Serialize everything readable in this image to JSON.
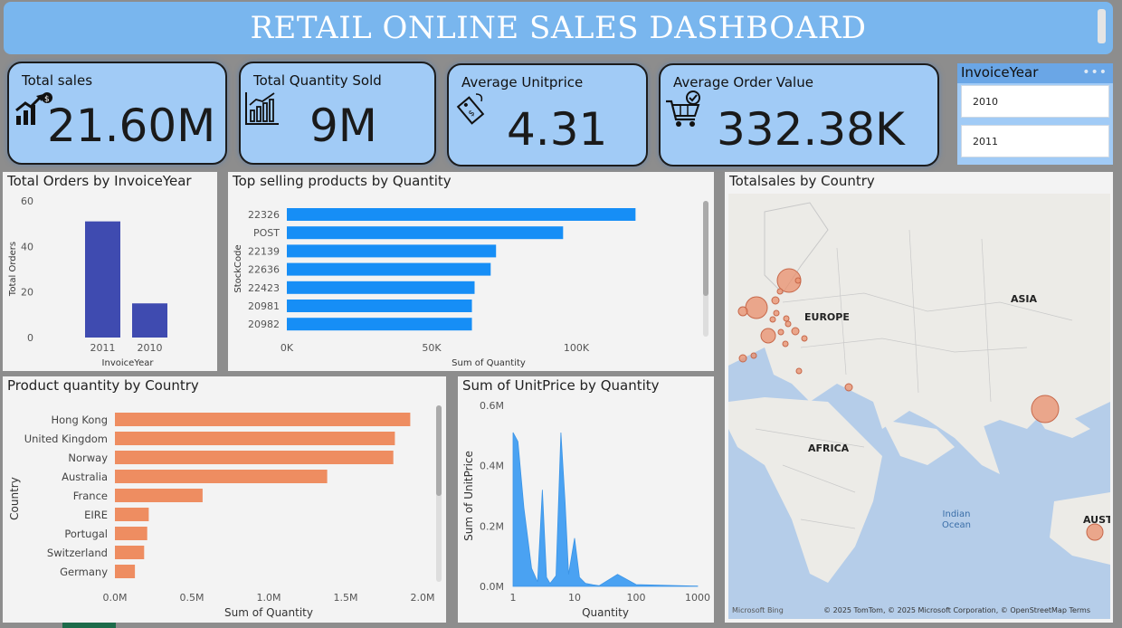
{
  "header": {
    "title": "RETAIL ONLINE SALES DASHBOARD"
  },
  "kpis": [
    {
      "label": "Total sales",
      "value": "21.60M",
      "icon": "sales-growth-icon"
    },
    {
      "label": "Total Quantity Sold",
      "value": "9M",
      "icon": "bar-chart-icon"
    },
    {
      "label": "Average Unitprice",
      "value": "4.31",
      "icon": "price-tag-icon"
    },
    {
      "label": "Average Order Value",
      "value": "332.38K",
      "icon": "shopping-cart-icon"
    }
  ],
  "slicer": {
    "title": "InvoiceYear",
    "options": [
      "2010",
      "2011"
    ]
  },
  "panels": {
    "orders_by_year": "Total Orders by InvoiceYear",
    "top_products": "Top selling products by Quantity",
    "sales_by_country": "Totalsales by Country",
    "qty_by_country": "Product quantity by Country",
    "unitprice_by_qty": "Sum of UnitPrice by Quantity"
  },
  "map": {
    "labels": [
      "EUROPE",
      "ASIA",
      "AFRICA",
      "AUSTI"
    ],
    "ocean": "Indian Ocean",
    "credit": "© 2025 TomTom, © 2025 Microsoft Corporation, © OpenStreetMap  Terms",
    "provider": "Microsoft Bing"
  },
  "chart_data": [
    {
      "type": "bar",
      "title": "Total Orders by InvoiceYear",
      "xlabel": "InvoiceYear",
      "ylabel": "Total Orders",
      "categories": [
        "2011",
        "2010"
      ],
      "values": [
        51,
        15
      ],
      "ylim": [
        0,
        60
      ],
      "yticks": [
        0,
        20,
        40,
        60
      ],
      "color": "#3f4bb0"
    },
    {
      "type": "bar",
      "orientation": "horizontal",
      "title": "Top selling products by Quantity",
      "xlabel": "Sum of Quantity",
      "ylabel": "StockCode",
      "categories": [
        "22326",
        "POST",
        "22139",
        "22636",
        "22423",
        "20981",
        "20982"
      ],
      "values": [
        130000,
        103000,
        78000,
        76000,
        70000,
        69000,
        69000
      ],
      "xlim": [
        0,
        140000
      ],
      "xticks": [
        "0K",
        "50K",
        "100K"
      ],
      "color": "#168ef6"
    },
    {
      "type": "bar",
      "orientation": "horizontal",
      "title": "Product quantity by Country",
      "xlabel": "Sum of Quantity",
      "ylabel": "Country",
      "categories": [
        "Hong Kong",
        "United Kingdom",
        "Norway",
        "Australia",
        "France",
        "EIRE",
        "Portugal",
        "Switzerland",
        "Germany"
      ],
      "values": [
        1920000,
        1820000,
        1810000,
        1380000,
        570000,
        220000,
        210000,
        190000,
        130000
      ],
      "xlim": [
        0,
        2000000
      ],
      "xticks": [
        "0.0M",
        "0.5M",
        "1.0M",
        "1.5M",
        "2.0M"
      ],
      "color": "#ee8d61"
    },
    {
      "type": "area",
      "title": "Sum of UnitPrice by Quantity",
      "xlabel": "Quantity",
      "ylabel": "Sum of UnitPrice",
      "xscale": "log",
      "xticks": [
        "1",
        "10",
        "100",
        "1000"
      ],
      "yticks": [
        "0.0M",
        "0.2M",
        "0.4M",
        "0.6M"
      ],
      "ylim": [
        0,
        600000
      ],
      "x": [
        1,
        1.2,
        1.5,
        2,
        2.5,
        3,
        3.5,
        4,
        5,
        6,
        7,
        8,
        10,
        12,
        15,
        20,
        25,
        50,
        100,
        1000
      ],
      "y": [
        510000,
        480000,
        260000,
        60000,
        15000,
        320000,
        30000,
        10000,
        35000,
        510000,
        280000,
        40000,
        160000,
        30000,
        10000,
        5000,
        2000,
        40000,
        6000,
        1000
      ],
      "color": "#4aa2f2"
    },
    {
      "type": "bubble-map",
      "title": "Totalsales by Country",
      "bubble_color": "#e98f6c"
    }
  ]
}
